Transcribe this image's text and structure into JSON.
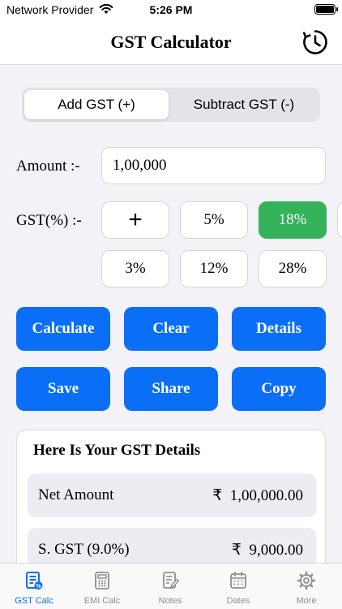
{
  "status_bar": {
    "carrier": "Network Provider",
    "time": "5:26 PM"
  },
  "nav": {
    "title": "GST Calculator",
    "history_icon": "clock-history-icon"
  },
  "mode_segment": {
    "options": [
      "Add GST (+)",
      "Subtract GST (-)"
    ],
    "selected": "Add GST (+)"
  },
  "amount": {
    "label": "Amount :-",
    "value": "1,00,000"
  },
  "gst": {
    "label": "GST(%) :-",
    "add_rate_symbol": "+",
    "rates": [
      "5%",
      "18%",
      "3%",
      "12%",
      "28%"
    ],
    "selected": "18%"
  },
  "actions": {
    "calculate": "Calculate",
    "clear": "Clear",
    "details": "Details",
    "save": "Save",
    "share": "Share",
    "copy": "Copy"
  },
  "details": {
    "title": "Here Is Your GST Details",
    "rows": [
      {
        "label": "Net Amount",
        "currency": "₹",
        "value": "1,00,000.00"
      },
      {
        "label": "S. GST (9.0%)",
        "currency": "₹",
        "value": "9,000.00"
      }
    ]
  },
  "tabs": [
    {
      "label": "GST Calc",
      "icon": "gst-calc-icon",
      "active": true
    },
    {
      "label": "EMI Calc",
      "icon": "calculator-icon",
      "active": false
    },
    {
      "label": "Notes",
      "icon": "notes-icon",
      "active": false
    },
    {
      "label": "Dates",
      "icon": "calendar-icon",
      "active": false
    },
    {
      "label": "More",
      "icon": "gear-icon",
      "active": false
    }
  ],
  "colors": {
    "accent": "#0b6ef6",
    "selected_rate": "#34b35a",
    "background": "#f2f2f7"
  }
}
